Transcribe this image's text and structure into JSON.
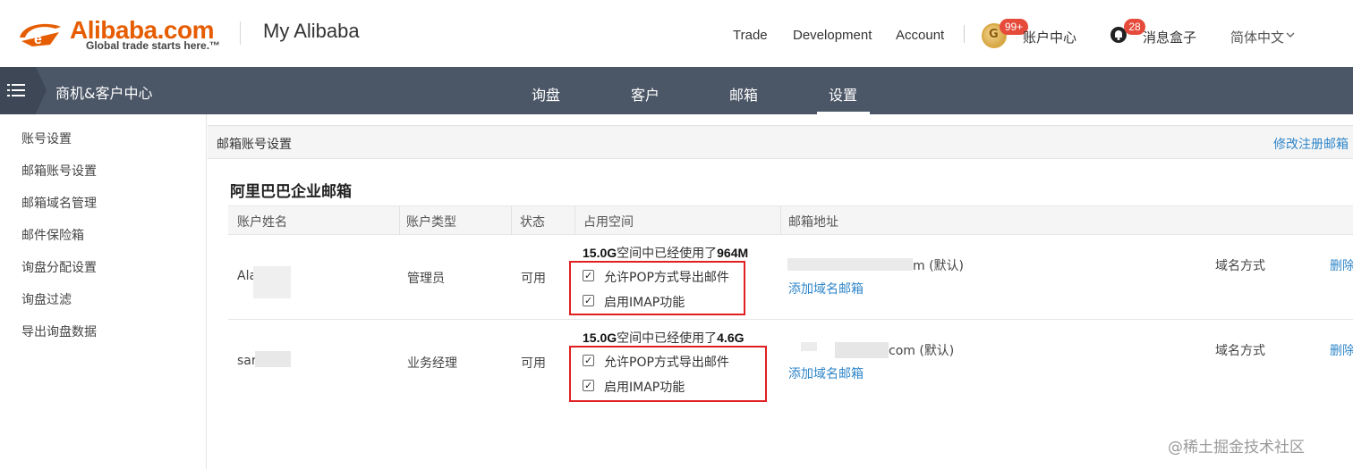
{
  "header": {
    "logo_word": "Alibaba.com",
    "logo_tagline": "Global trade starts here.™",
    "site_title": "My Alibaba",
    "nav": [
      "Trade",
      "Development",
      "Account"
    ],
    "account_badge": "99+",
    "account_center": "账户中心",
    "message_badge": "28",
    "message_box": "消息盒子",
    "language": "简体中文"
  },
  "navbar": {
    "title": "商机&客户中心",
    "tabs": [
      "询盘",
      "客户",
      "邮箱",
      "设置"
    ],
    "active_tab": "设置"
  },
  "sidebar": {
    "items": [
      "账号设置",
      "邮箱账号设置",
      "邮箱域名管理",
      "邮件保险箱",
      "询盘分配设置",
      "询盘过滤",
      "导出询盘数据"
    ]
  },
  "panel": {
    "title": "邮箱账号设置",
    "link": "修改注册邮箱"
  },
  "section": {
    "title": "阿里巴巴企业邮箱"
  },
  "table": {
    "headers": [
      "账户姓名",
      "账户类型",
      "状态",
      "占用空间",
      "邮箱地址"
    ],
    "rows": [
      {
        "name": "Ala",
        "type": "管理员",
        "status": "可用",
        "quota": "15.0G",
        "usage_text": "空间中已经使用了",
        "used": "964M",
        "pop_label": "允许POP方式导出邮件",
        "imap_label": "启用IMAP功能",
        "email_visible": "m (默认)",
        "add_domain": "添加域名邮箱",
        "domain_mode": "域名方式",
        "delete": "删除"
      },
      {
        "name": "sar",
        "type": "业务经理",
        "status": "可用",
        "quota": "15.0G",
        "usage_text": "空间中已经使用了",
        "used": "4.6G",
        "pop_label": "允许POP方式导出邮件",
        "imap_label": "启用IMAP功能",
        "email_visible": "com (默认)",
        "add_domain": "添加域名邮箱",
        "domain_mode": "域名方式",
        "delete": "删除"
      }
    ]
  },
  "watermark": "@稀土掘金技术社区",
  "colors": {
    "brand_orange": "#e65c00",
    "navbar": "#4b5666",
    "link": "#2f86c9",
    "badge": "#e64a3a",
    "highlight_box": "#e02020"
  }
}
